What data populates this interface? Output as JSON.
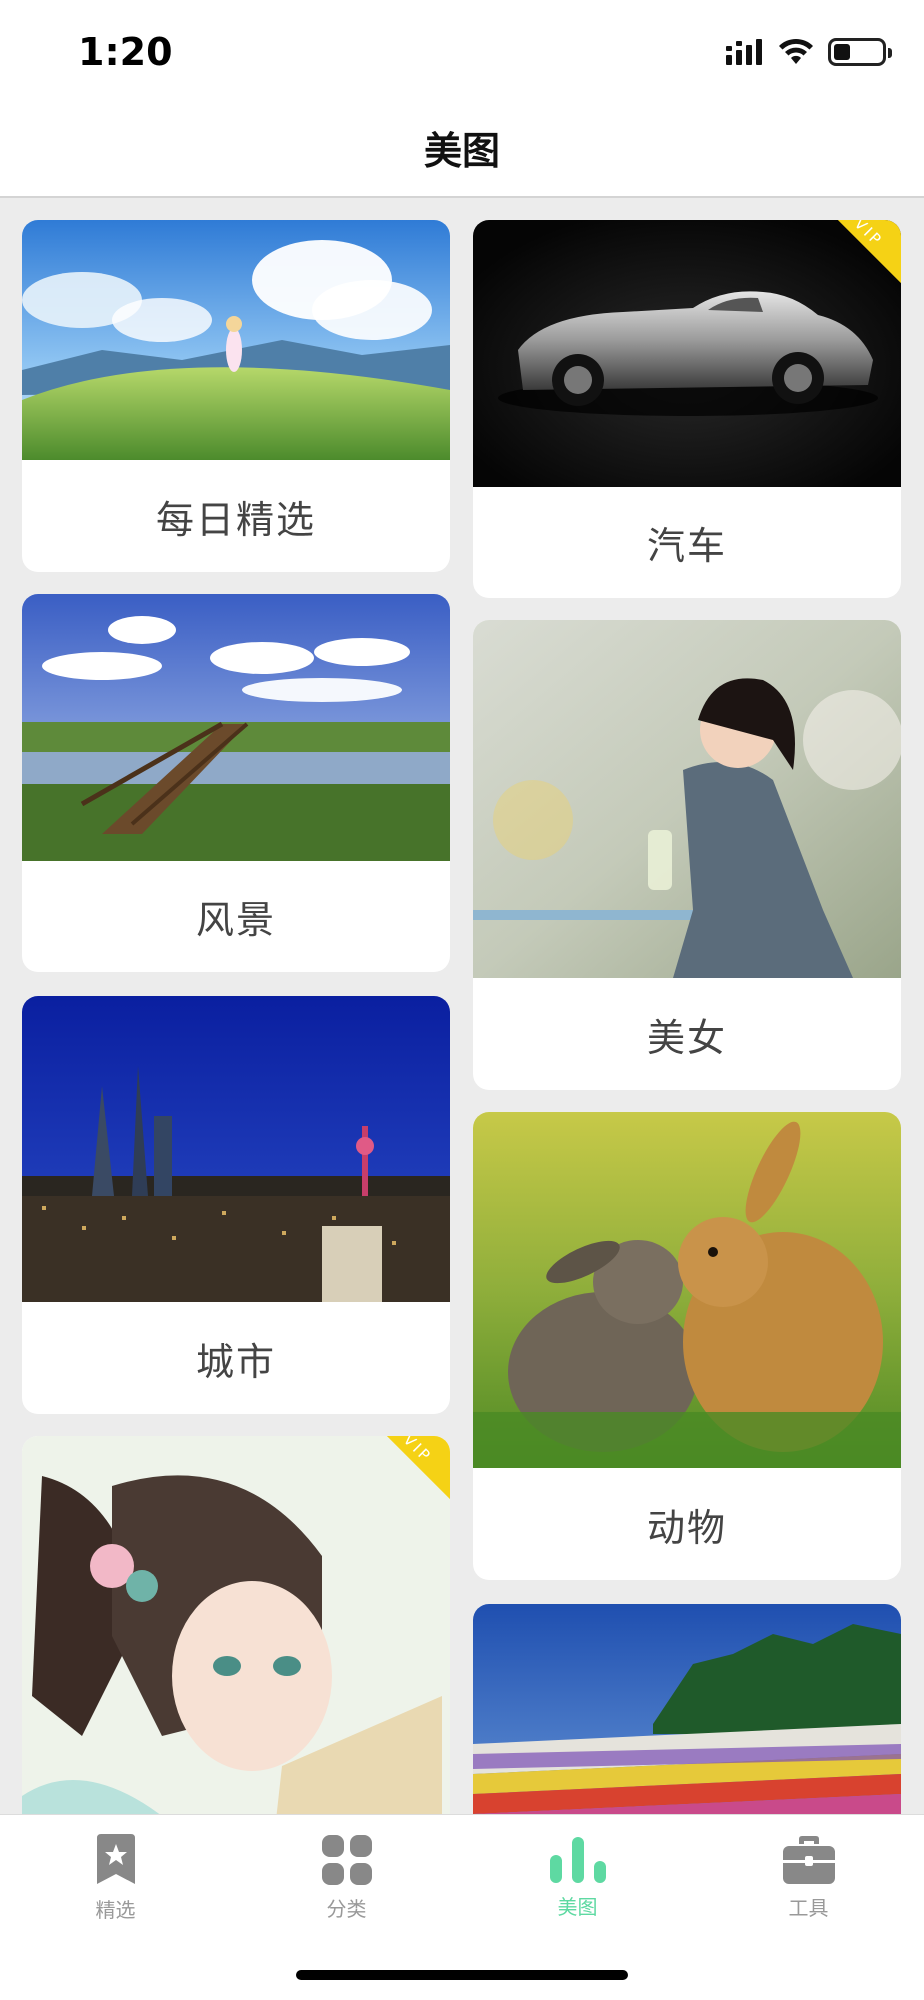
{
  "status": {
    "time": "1:20"
  },
  "nav": {
    "title": "美图"
  },
  "cards": [
    {
      "label": "每日精选",
      "vip": false
    },
    {
      "label": "汽车",
      "vip": true
    },
    {
      "label": "风景",
      "vip": false
    },
    {
      "label": "美女",
      "vip": false
    },
    {
      "label": "城市",
      "vip": false
    },
    {
      "label": "动物",
      "vip": false
    },
    {
      "label": "",
      "vip": true
    },
    {
      "label": "",
      "vip": false
    }
  ],
  "vip_badge": "VIP",
  "tabs": [
    {
      "label": "精选",
      "icon": "bookmark-star-icon",
      "active": false
    },
    {
      "label": "分类",
      "icon": "grid-icon",
      "active": false
    },
    {
      "label": "美图",
      "icon": "bar-chart-icon",
      "active": true
    },
    {
      "label": "工具",
      "icon": "toolbox-icon",
      "active": false
    }
  ],
  "colors": {
    "accent": "#5ed9a2",
    "vip": "#f5d215",
    "inactive": "#999999"
  }
}
